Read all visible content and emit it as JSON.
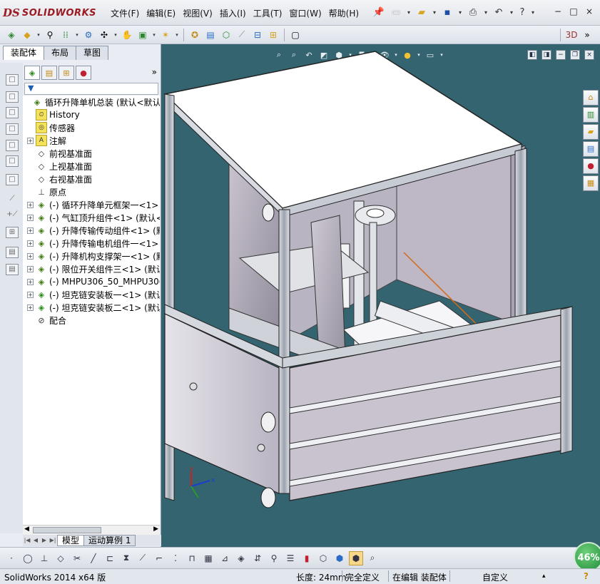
{
  "app": {
    "logo_ds": "DS",
    "logo_brand": "SOLIDWORKS"
  },
  "menubar": {
    "items": [
      "文件(F)",
      "编辑(E)",
      "视图(V)",
      "插入(I)",
      "工具(T)",
      "窗口(W)",
      "帮助(H)"
    ]
  },
  "window_controls": {
    "minimize": "−",
    "restore": "□",
    "close": "×"
  },
  "left_panel": {
    "tabs": [
      "装配体",
      "布局",
      "草图"
    ],
    "active_tab": 0,
    "more": "»",
    "filter_icon": "funnel-icon",
    "tree": [
      {
        "label": "循环升降单机总装  (默认<默认_显",
        "icon": "assembly-icon",
        "expander": "",
        "level": 0
      },
      {
        "label": "History",
        "icon": "history-icon",
        "expander": "",
        "level": 1
      },
      {
        "label": "传感器",
        "icon": "sensor-icon",
        "expander": "",
        "level": 1
      },
      {
        "label": "注解",
        "icon": "annotation-icon",
        "expander": "+",
        "level": 1
      },
      {
        "label": "前视基准面",
        "icon": "plane-icon",
        "expander": "",
        "level": 1
      },
      {
        "label": "上视基准面",
        "icon": "plane-icon",
        "expander": "",
        "level": 1
      },
      {
        "label": "右视基准面",
        "icon": "plane-icon",
        "expander": "",
        "level": 1
      },
      {
        "label": "原点",
        "icon": "origin-icon",
        "expander": "",
        "level": 1
      },
      {
        "label": "(-) 循环升降单元框架一<1> (",
        "icon": "subassembly-icon",
        "expander": "+",
        "level": 1
      },
      {
        "label": "(-) 气缸顶升组件<1> (默认<第",
        "icon": "subassembly-icon",
        "expander": "+",
        "level": 1
      },
      {
        "label": "(-) 升降传输传动组件<1> (默",
        "icon": "subassembly-icon",
        "expander": "+",
        "level": 1
      },
      {
        "label": "(-) 升降传输电机组件一<1> (",
        "icon": "subassembly-icon",
        "expander": "+",
        "level": 1
      },
      {
        "label": "(-) 升降机构支撑架一<1> (默",
        "icon": "subassembly-icon",
        "expander": "+",
        "level": 1
      },
      {
        "label": "(-) 限位开关组件三<1> (默认",
        "icon": "subassembly-icon",
        "expander": "+",
        "level": 1
      },
      {
        "label": "(-) MHPU306_50_MHPU306-50<",
        "icon": "subassembly-icon",
        "expander": "+",
        "level": 1
      },
      {
        "label": "(-) 坦克链安装板一<1> (默认",
        "icon": "part-icon",
        "expander": "+",
        "level": 1
      },
      {
        "label": "(-) 坦克链安装板二<1> (默认",
        "icon": "part-icon",
        "expander": "+",
        "level": 1
      },
      {
        "label": "配合",
        "icon": "mates-icon",
        "expander": "",
        "level": 1
      }
    ]
  },
  "bottom_tabs": {
    "items": [
      "模型",
      "运动算例 1"
    ],
    "active": 0
  },
  "viewport": {
    "background": "#336470",
    "triad": {
      "x": "x",
      "y": "y",
      "z": "z"
    }
  },
  "zoom_badge": "46%",
  "status_bar": {
    "version": "SolidWorks 2014 x64 版",
    "length": "长度: 24mm",
    "definition": "完全定义",
    "mode": "在编辑 装配体",
    "units": "自定义",
    "help": "?"
  }
}
